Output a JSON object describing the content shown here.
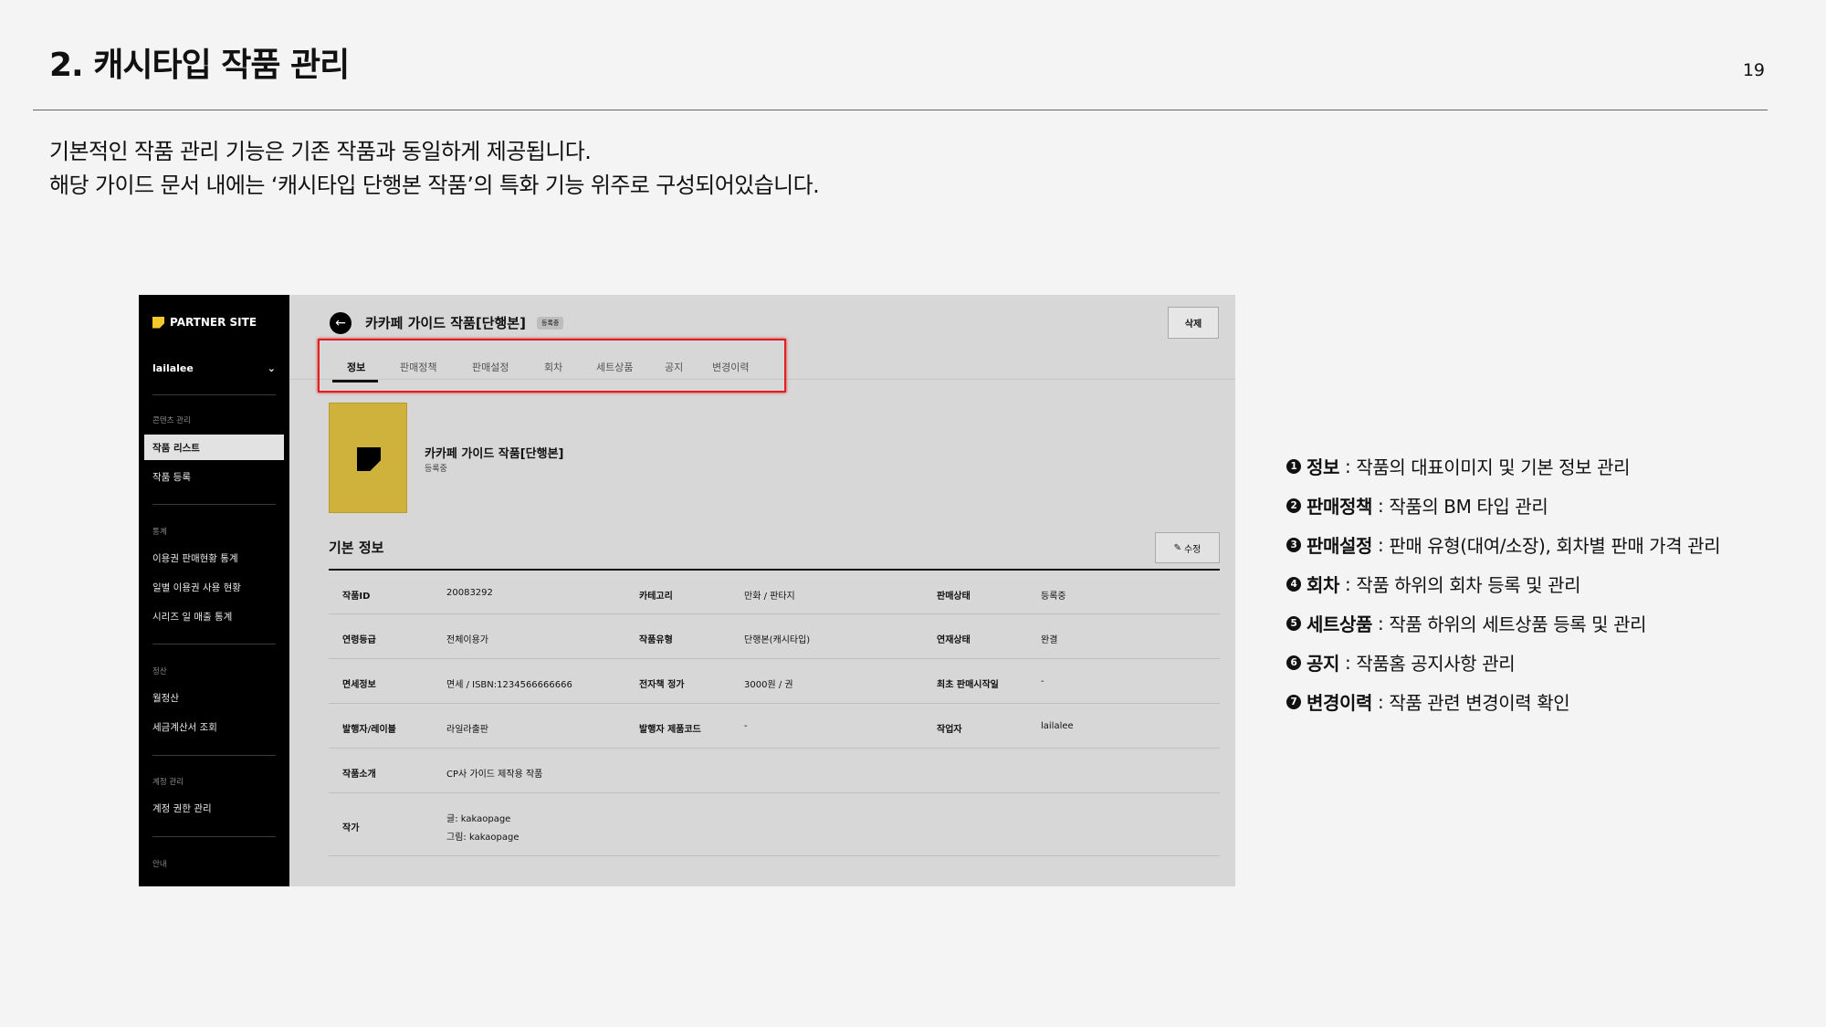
{
  "slide": {
    "title": "2. 캐시타입 작품 관리",
    "page_number": "19",
    "intro_line1": "기본적인 작품 관리 기능은 기존 작품과 동일하게 제공됩니다.",
    "intro_line2": "해당 가이드 문서 내에는 ‘캐시타입 단행본 작품’의 특화 기능 위주로 구성되어있습니다."
  },
  "screenshot": {
    "sidebar": {
      "logo": "PARTNER SITE",
      "user": "lailalee",
      "user_chevron": "⌄",
      "groups": [
        {
          "label": "콘텐츠 관리",
          "items": [
            "작품 리스트",
            "작품 등록"
          ]
        },
        {
          "label": "통계",
          "items": [
            "이용권 판매현황 통계",
            "일별 이용권 사용 현황",
            "시리즈 일 매출 통계"
          ]
        },
        {
          "label": "정산",
          "items": [
            "월정산",
            "세금계산서 조회"
          ]
        },
        {
          "label": "계정 관리",
          "items": [
            "계정 권한 관리"
          ]
        },
        {
          "label": "안내",
          "items": []
        }
      ]
    },
    "header": {
      "back_glyph": "←",
      "title": "카카페 가이드 작품[단행본]",
      "badge": "등록중",
      "delete_label": "삭제"
    },
    "tabs": [
      "정보",
      "판매정책",
      "판매설정",
      "회차",
      "세트상품",
      "공지",
      "변경이력"
    ],
    "work": {
      "title": "카카페 가이드 작품[단행본]",
      "status": "등록중"
    },
    "section": {
      "title": "기본 정보",
      "edit_label": "수정",
      "edit_icon": "✎"
    },
    "info_rows": [
      [
        {
          "label": "작품ID",
          "value": "20083292"
        },
        {
          "label": "카테고리",
          "value": "만화 / 판타지"
        },
        {
          "label": "판매상태",
          "value": "등록중"
        }
      ],
      [
        {
          "label": "연령등급",
          "value": "전체이용가"
        },
        {
          "label": "작품유형",
          "value": "단행본(캐시타입)"
        },
        {
          "label": "연재상태",
          "value": "완결"
        }
      ],
      [
        {
          "label": "면세정보",
          "value": "면세 / ISBN:1234566666666"
        },
        {
          "label": "전자책 정가",
          "value": "3000원 / 권"
        },
        {
          "label": "최초 판매시작일",
          "value": "-"
        }
      ],
      [
        {
          "label": "발행자/레이블",
          "value": "라일라출판"
        },
        {
          "label": "발행자 제품코드",
          "value": "-"
        },
        {
          "label": "작업자",
          "value": "lailalee"
        }
      ]
    ],
    "intro_row": {
      "label": "작품소개",
      "value": "CP사 가이드 제작용 작품"
    },
    "author_row": {
      "label": "작가",
      "line1": "글: kakaopage",
      "line2": "그림: kakaopage"
    }
  },
  "legend": [
    {
      "num": "1",
      "keyword": "정보",
      "desc": "작품의 대표이미지 및 기본 정보 관리"
    },
    {
      "num": "2",
      "keyword": "판매정책",
      "desc": "작품의 BM 타입 관리"
    },
    {
      "num": "3",
      "keyword": "판매설정",
      "desc": "판매 유형(대여/소장), 회차별 판매 가격 관리"
    },
    {
      "num": "4",
      "keyword": "회차",
      "desc": "작품 하위의 회차 등록 및 관리"
    },
    {
      "num": "5",
      "keyword": "세트상품",
      "desc": "작품 하위의 세트상품 등록 및 관리"
    },
    {
      "num": "6",
      "keyword": "공지",
      "desc": "작품홈 공지사항 관리"
    },
    {
      "num": "7",
      "keyword": "변경이력",
      "desc": "작품 관련 변경이력 확인"
    }
  ],
  "colors": {
    "highlight": "#e02020",
    "cover": "#cfb23c",
    "sidebar": "#000000",
    "logo_accent": "#f3c82a"
  }
}
